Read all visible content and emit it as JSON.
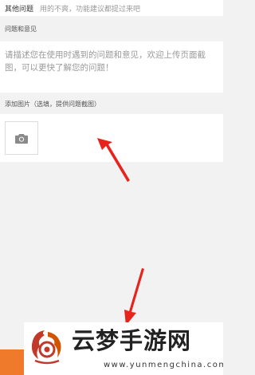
{
  "header": {
    "title": "其他问题",
    "description": "用的不爽，功能建议都提过来吧"
  },
  "feedback": {
    "label": "问题和意见",
    "placeholder": "请描述您在使用时遇到的问题和意见，欢迎上传页面截图，可以更快了解您的问题！"
  },
  "attachments": {
    "label": "添加图片（选填，提供问题截图）",
    "add_icon": "camera-icon"
  },
  "annotations": {
    "arrow_color": "#e8231c"
  },
  "watermark": {
    "brand": "云梦手游网",
    "url": "www.yunmengchina.com",
    "logo_color": "#c0392b"
  },
  "colors": {
    "accent": "#f07a2c",
    "background": "#f2f2f2"
  }
}
